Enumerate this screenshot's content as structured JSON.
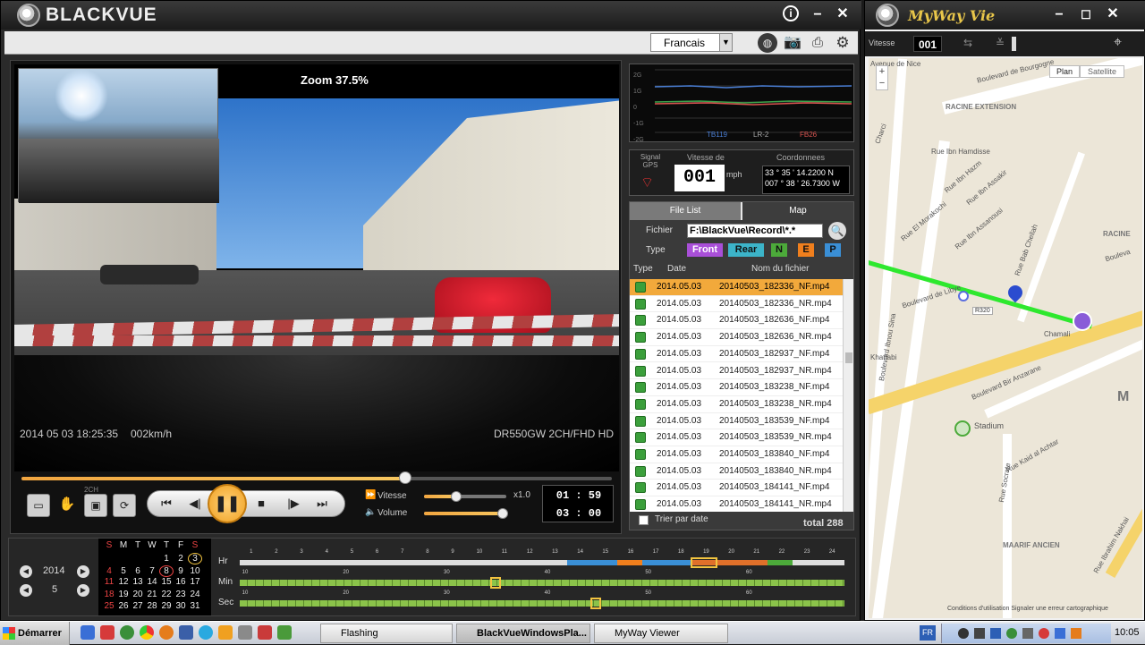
{
  "blackvue": {
    "title": "BLACKVUE",
    "language": "Francais",
    "video": {
      "zoom": "Zoom 37.5%",
      "timestamp": "2014 05 03  18:25:35",
      "speed": "002km/h",
      "model": "DR550GW 2CH/FHD HD"
    },
    "controls": {
      "mode_label": "2CH",
      "speed_label": "Vitesse",
      "volume_label": "Volume",
      "speed_value": "x1.0",
      "elapsed": "01 : 59",
      "total": "03 : 00",
      "progress": 0.65,
      "speed_slider": 0.65,
      "volume_slider": 1.0
    },
    "gsensor": {
      "y_ticks": [
        "2G",
        "1G",
        "0",
        "-1G",
        "-2G"
      ],
      "tags": [
        "TB119",
        "LR-2",
        "FB26"
      ]
    },
    "gps": {
      "signal_label": "Signal GPS",
      "speed_label": "Vitesse de",
      "speed_value": "001",
      "speed_unit": "mph",
      "coord_label": "Coordonnees",
      "lat": "33 ° 35 ' 14.2200 N",
      "lon": "007 ° 38 ' 26.7300 W"
    },
    "filelist": {
      "tabs": [
        "File List",
        "Map"
      ],
      "file_label": "Fichier",
      "file_value": "F:\\BlackVue\\Record\\*.*",
      "type_label": "Type",
      "types": [
        "Front",
        "Rear",
        "N",
        "E",
        "P"
      ],
      "col_type": "Type",
      "col_date": "Date",
      "col_name": "Nom du fichier",
      "sort_label": "Trier par date",
      "total": "total 288",
      "rows": [
        {
          "date": "2014.05.03",
          "name": "20140503_182336_NF.mp4"
        },
        {
          "date": "2014.05.03",
          "name": "20140503_182336_NR.mp4"
        },
        {
          "date": "2014.05.03",
          "name": "20140503_182636_NF.mp4"
        },
        {
          "date": "2014.05.03",
          "name": "20140503_182636_NR.mp4"
        },
        {
          "date": "2014.05.03",
          "name": "20140503_182937_NF.mp4"
        },
        {
          "date": "2014.05.03",
          "name": "20140503_182937_NR.mp4"
        },
        {
          "date": "2014.05.03",
          "name": "20140503_183238_NF.mp4"
        },
        {
          "date": "2014.05.03",
          "name": "20140503_183238_NR.mp4"
        },
        {
          "date": "2014.05.03",
          "name": "20140503_183539_NF.mp4"
        },
        {
          "date": "2014.05.03",
          "name": "20140503_183539_NR.mp4"
        },
        {
          "date": "2014.05.03",
          "name": "20140503_183840_NF.mp4"
        },
        {
          "date": "2014.05.03",
          "name": "20140503_183840_NR.mp4"
        },
        {
          "date": "2014.05.03",
          "name": "20140503_184141_NF.mp4"
        },
        {
          "date": "2014.05.03",
          "name": "20140503_184141_NR.mp4"
        }
      ]
    },
    "calendar": {
      "year": "2014",
      "month": "5",
      "weekdays": [
        "S",
        "M",
        "T",
        "W",
        "T",
        "F",
        "S"
      ],
      "weeks": [
        [
          "",
          "",
          "",
          "",
          "1",
          "2",
          "3"
        ],
        [
          "4",
          "5",
          "6",
          "7",
          "8",
          "9",
          "10"
        ],
        [
          "11",
          "12",
          "13",
          "14",
          "15",
          "16",
          "17"
        ],
        [
          "18",
          "19",
          "20",
          "21",
          "22",
          "23",
          "24"
        ],
        [
          "25",
          "26",
          "27",
          "28",
          "29",
          "30",
          "31"
        ]
      ]
    },
    "timeline": {
      "hr_label": "Hr",
      "min_label": "Min",
      "sec_label": "Sec",
      "hours": [
        "1",
        "2",
        "3",
        "4",
        "5",
        "6",
        "7",
        "8",
        "9",
        "10",
        "11",
        "12",
        "13",
        "14",
        "15",
        "16",
        "17",
        "18",
        "19",
        "20",
        "21",
        "22",
        "23",
        "24"
      ],
      "min_ticks": [
        "10",
        "20",
        "30",
        "40",
        "50",
        "60"
      ]
    }
  },
  "myway": {
    "title": "MyWay Vie",
    "speed_label": "Vitesse",
    "speed_value": "001",
    "map_buttons": [
      "Plan",
      "Satellite"
    ],
    "zoom_in": "+",
    "zoom_out": "−",
    "labels": {
      "avenue_nice": "Avenue de Nice",
      "bd_bourgogne": "Boulevard de Bourgogne",
      "racine_ext": "RACINE EXTENSION",
      "racine": "RACINE",
      "charci": "Charci",
      "rue_ibn_hamdisse": "Rue Ibn Hamdisse",
      "rue_ibn_hazm": "Rue Ibn Hazm",
      "rue_ibn_assakir": "Rue Ibn Assakir",
      "rue_el_morakochi": "Rue El Morakochi",
      "rue_ibn_assanousi": "Rue Ibn Assanousi",
      "rue_bab_chellah": "Rue Bab Chellah",
      "bd_libye": "Boulevard de Libye",
      "r320": "R320",
      "khattabi": "Khattabi",
      "bd_ibnou_sina": "Boulevard Ibnou Sina",
      "chamali": "Chamali",
      "bd_bir_anzarane": "Boulevard Bir Anzarane",
      "stadium": "Stadium",
      "rue_socrate": "Rue Socrate",
      "rue_kaid": "Rue Kaid al Achtar",
      "maarif": "MAARIF ANCIEN",
      "rue_ibn_ibrahim": "Rue Ibrahim Nakhai",
      "bouleva": "Bouleva",
      "footer": "Conditions d'utilisation  Signaler une erreur cartographique",
      "m": "M"
    }
  },
  "taskbar": {
    "start": "Démarrer",
    "tasks": [
      "Flashing",
      "BlackVueWindowsPla...",
      "MyWay Viewer"
    ],
    "lang": "FR",
    "clock": "10:05"
  }
}
